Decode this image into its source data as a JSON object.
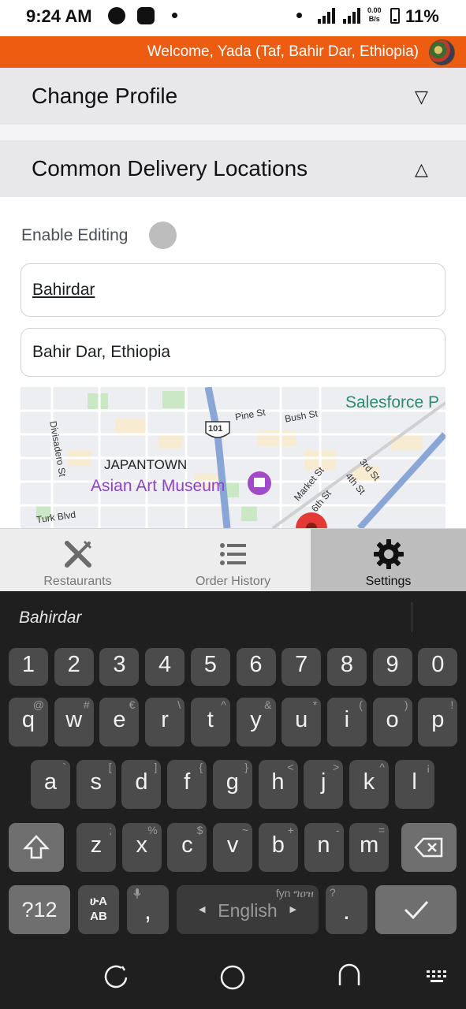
{
  "status_bar": {
    "time": "9:24 AM",
    "net_speed_value": "0.00",
    "net_speed_unit": "B/s",
    "battery": "11%"
  },
  "header": {
    "welcome": "Welcome, Yada (Taf, Bahir Dar, Ethiopia)",
    "accent_color": "#ee5c12"
  },
  "sections": {
    "change_profile": {
      "title": "Change Profile",
      "toggle_glyph": "▽"
    },
    "delivery_locations": {
      "title": "Common Delivery Locations",
      "toggle_glyph": "△"
    }
  },
  "delivery_form": {
    "enable_editing_label": "Enable Editing",
    "location_name": "Bahirdar",
    "location_address": "Bahir Dar, Ethiopia"
  },
  "map": {
    "labels": {
      "salesforce": "Salesforce P",
      "japantown": "JAPANTOWN",
      "museum": "Asian Art Museum",
      "divisadero": "Divisadero St",
      "pine": "Pine St",
      "bush": "Bush St",
      "hwy": "101",
      "third": "3rd St",
      "fourth": "4th St",
      "market": "Market St",
      "sixth": "6th St",
      "turk": "Turk Blvd"
    }
  },
  "tabs": [
    {
      "label": "Restaurants",
      "icon": "fork-knife-icon",
      "active": false
    },
    {
      "label": "Order History",
      "icon": "list-icon",
      "active": false
    },
    {
      "label": "Settings",
      "icon": "gear-icon",
      "active": true
    }
  ],
  "keyboard": {
    "suggestion": "Bahirdar",
    "numbers": [
      "1",
      "2",
      "3",
      "4",
      "5",
      "6",
      "7",
      "8",
      "9",
      "0"
    ],
    "row1": [
      {
        "k": "q",
        "a": "@"
      },
      {
        "k": "w",
        "a": "#"
      },
      {
        "k": "e",
        "a": "€"
      },
      {
        "k": "r",
        "a": "\\"
      },
      {
        "k": "t",
        "a": "^"
      },
      {
        "k": "y",
        "a": "&"
      },
      {
        "k": "u",
        "a": "*"
      },
      {
        "k": "i",
        "a": "("
      },
      {
        "k": "o",
        "a": ")"
      },
      {
        "k": "p",
        "a": "!"
      }
    ],
    "row2": [
      {
        "k": "a",
        "a": "`"
      },
      {
        "k": "s",
        "a": "["
      },
      {
        "k": "d",
        "a": "]"
      },
      {
        "k": "f",
        "a": "{"
      },
      {
        "k": "g",
        "a": "}"
      },
      {
        "k": "h",
        "a": "<"
      },
      {
        "k": "j",
        "a": ">"
      },
      {
        "k": "k",
        "a": "^"
      },
      {
        "k": "l",
        "a": "¡"
      }
    ],
    "row3": [
      {
        "k": "z",
        "a": ";"
      },
      {
        "k": "x",
        "a": "%"
      },
      {
        "k": "c",
        "a": "$"
      },
      {
        "k": "v",
        "a": "~"
      },
      {
        "k": "b",
        "a": "+"
      },
      {
        "k": "n",
        "a": "-"
      },
      {
        "k": "m",
        "a": "="
      }
    ],
    "symbols_label": "?12",
    "lang_switch_top": "ሁA",
    "lang_switch_bottom": "AB",
    "comma": ",",
    "space_label": "English",
    "space_alt": "fyn ግዐዝ",
    "period": ".",
    "period_alt": "?"
  }
}
